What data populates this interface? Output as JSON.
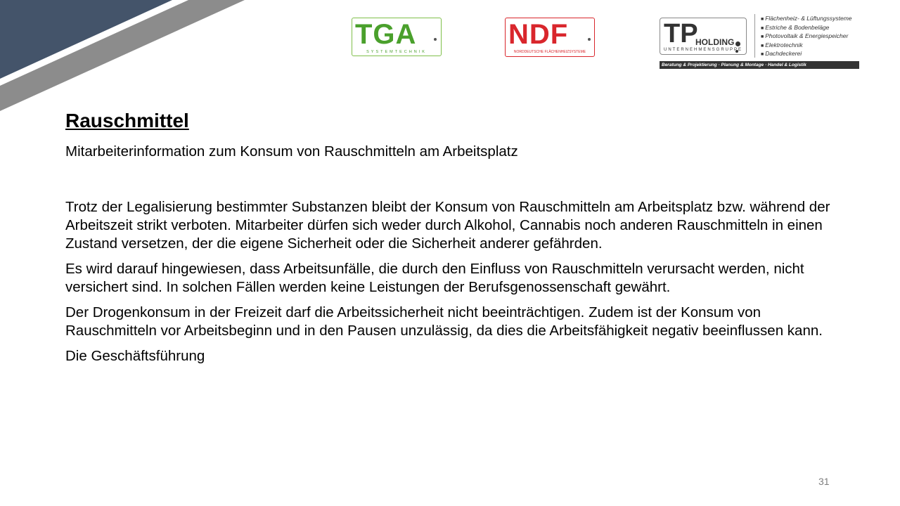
{
  "logos": {
    "tga": {
      "name": "TGA",
      "tagline": "SYSTEMTECHNIK",
      "color": "#4aa02c"
    },
    "ndf": {
      "name": "NDF",
      "tagline": "NORDDEUTSCHE FLÄCHENHEIZSYSTEME",
      "color": "#d9262c"
    },
    "tp": {
      "name": "TP",
      "suffix": "HOLDING",
      "tagline": "UNTERNEHMENSGRUPPE",
      "services": [
        "Flächenheiz- & Lüftungssysteme",
        "Estriche & Bodenbeläge",
        "Photovoltaik & Energiespeicher",
        "Elektrotechnik",
        "Dachdeckerei"
      ],
      "bar": "Beratung & Projektierung · Planung & Montage · Handel & Logistik"
    }
  },
  "title": "Rauschmittel",
  "subtitle": "Mitarbeiterinformation zum Konsum von Rauschmitteln am Arbeitsplatz",
  "paragraphs": [
    "Trotz der Legalisierung bestimmter Substanzen bleibt der Konsum von Rauschmitteln am Arbeitsplatz bzw. während der Arbeitszeit strikt verboten. Mitarbeiter dürfen sich weder durch Alkohol, Cannabis noch anderen Rauschmitteln in einen Zustand versetzen, der die eigene Sicherheit oder die Sicherheit anderer gefährden.",
    "Es wird darauf hingewiesen, dass Arbeitsunfälle, die durch den Einfluss von Rauschmitteln verursacht werden, nicht versichert sind. In solchen Fällen werden keine Leistungen der Berufsgenossenschaft gewährt.",
    "Der Drogenkonsum in der Freizeit darf die Arbeitssicherheit nicht beeinträchtigen. Zudem ist der Konsum von Rauschmitteln vor Arbeitsbeginn und in den Pausen unzulässig, da dies die Arbeitsfähigkeit negativ beeinflussen kann.",
    "Die Geschäftsführung"
  ],
  "page_number": "31",
  "colors": {
    "corner_dark": "#44546a",
    "corner_stripe": "#8c8c8c"
  }
}
